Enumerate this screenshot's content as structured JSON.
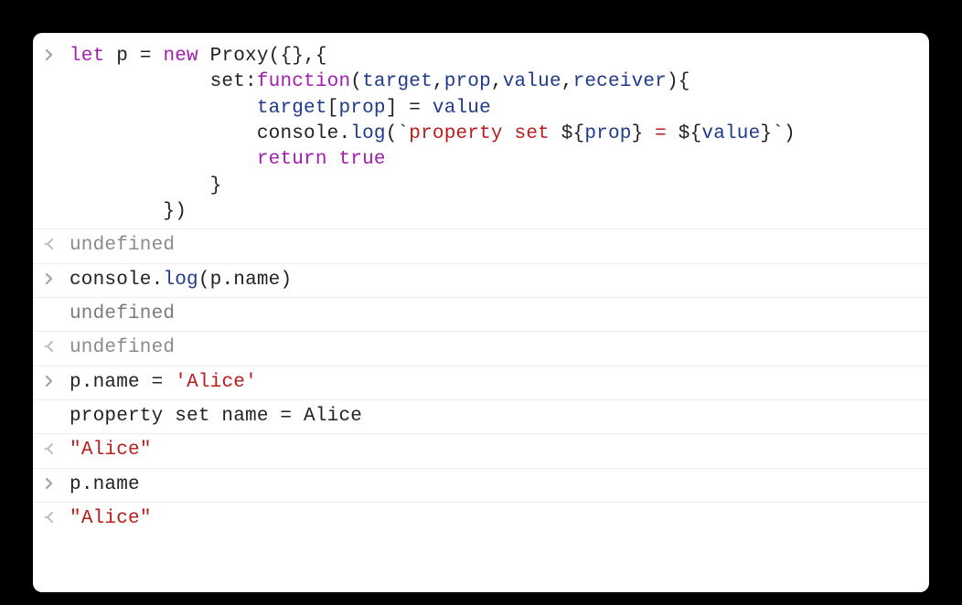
{
  "rows": {
    "r0": {
      "tokens": {
        "let": "let",
        "sp1": " ",
        "p": "p",
        "eq": " = ",
        "new": "new",
        "sp2": " ",
        "proxy": "Proxy",
        "open": "({},{",
        "nl1": "\n",
        "indent2": "            ",
        "setkey": "set",
        "colon": ":",
        "function": "function",
        "paren1": "(",
        "target": "target",
        "c1": ",",
        "prop": "prop",
        "c2": ",",
        "value": "value",
        "c3": ",",
        "receiver": "receiver",
        "paren2": "){",
        "nl2": "\n",
        "indent3": "                ",
        "targetB": "target",
        "brO": "[",
        "propB": "prop",
        "brC": "] = ",
        "valueB": "value",
        "nl3": "\n",
        "indent3b": "                ",
        "console": "console",
        "dot": ".",
        "log": "log",
        "tplO": "(`",
        "tplTxt": "property set ",
        "iO1": "${",
        "iV1": "prop",
        "iC1": "}",
        "tplMid": " = ",
        "iO2": "${",
        "iV2": "value",
        "iC2": "}",
        "tplC": "`)",
        "nl4": "\n",
        "indent3c": "                ",
        "return": "return",
        "sp3": " ",
        "true": "true",
        "nl5": "\n",
        "indent2b": "            ",
        "close1": "}",
        "nl6": "\n",
        "indent1": "        ",
        "close2": "})"
      }
    },
    "r1": {
      "text": "undefined"
    },
    "r2": {
      "tokens": {
        "console": "console",
        "dot": ".",
        "log": "log",
        "open": "(",
        "p": "p",
        "dot2": ".",
        "name": "name",
        "close": ")"
      }
    },
    "r3": {
      "text": "undefined"
    },
    "r4": {
      "text": "undefined"
    },
    "r5": {
      "tokens": {
        "p": "p",
        "dot": ".",
        "name": "name",
        "eq": " = ",
        "q1": "'",
        "val": "Alice",
        "q2": "'"
      }
    },
    "r6": {
      "text": "property set name = Alice"
    },
    "r7": {
      "tokens": {
        "q1": "\"",
        "val": "Alice",
        "q2": "\""
      }
    },
    "r8": {
      "tokens": {
        "p": "p",
        "dot": ".",
        "name": "name"
      }
    },
    "r9": {
      "tokens": {
        "q1": "\"",
        "val": "Alice",
        "q2": "\""
      }
    }
  }
}
